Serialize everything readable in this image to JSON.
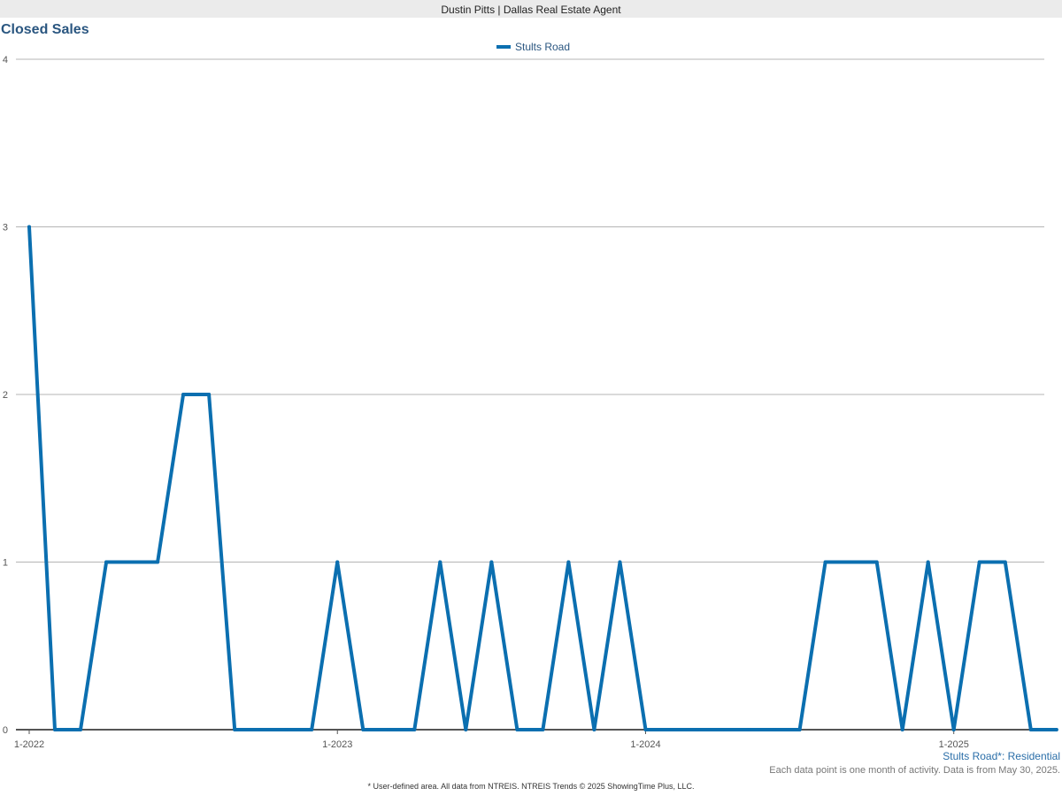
{
  "header": {
    "text": "Dustin Pitts | Dallas Real Estate Agent"
  },
  "chart_data": {
    "type": "line",
    "title": "Closed Sales",
    "xlabel": "",
    "ylabel": "",
    "ylim": [
      0,
      4
    ],
    "y_ticks": [
      "0",
      "1",
      "2",
      "3",
      "4"
    ],
    "x_ticks": [
      "1-2022",
      "1-2023",
      "1-2024",
      "1-2025"
    ],
    "grid": true,
    "legend_position": "top-center",
    "x": [
      "1-2022",
      "2-2022",
      "3-2022",
      "4-2022",
      "5-2022",
      "6-2022",
      "7-2022",
      "8-2022",
      "9-2022",
      "10-2022",
      "11-2022",
      "12-2022",
      "1-2023",
      "2-2023",
      "3-2023",
      "4-2023",
      "5-2023",
      "6-2023",
      "7-2023",
      "8-2023",
      "9-2023",
      "10-2023",
      "11-2023",
      "12-2023",
      "1-2024",
      "2-2024",
      "3-2024",
      "4-2024",
      "5-2024",
      "6-2024",
      "7-2024",
      "8-2024",
      "9-2024",
      "10-2024",
      "11-2024",
      "12-2024",
      "1-2025",
      "2-2025",
      "3-2025",
      "4-2025",
      "5-2025"
    ],
    "series": [
      {
        "name": "Stults Road",
        "color": "#0b6fb0",
        "values": [
          3,
          0,
          0,
          1,
          1,
          1,
          2,
          2,
          0,
          0,
          0,
          0,
          1,
          0,
          0,
          0,
          1,
          0,
          1,
          0,
          0,
          1,
          0,
          1,
          0,
          0,
          0,
          0,
          0,
          0,
          0,
          1,
          1,
          1,
          0,
          1,
          0,
          1,
          1,
          0,
          0
        ]
      }
    ]
  },
  "notes": {
    "area": "Stults Road*: Residential",
    "activity": "Each data point is one month of activity. Data is from May 30, 2025."
  },
  "footer": {
    "text": "* User-defined area. All data from NTREIS. NTREIS Trends © 2025 ShowingTime Plus, LLC."
  }
}
